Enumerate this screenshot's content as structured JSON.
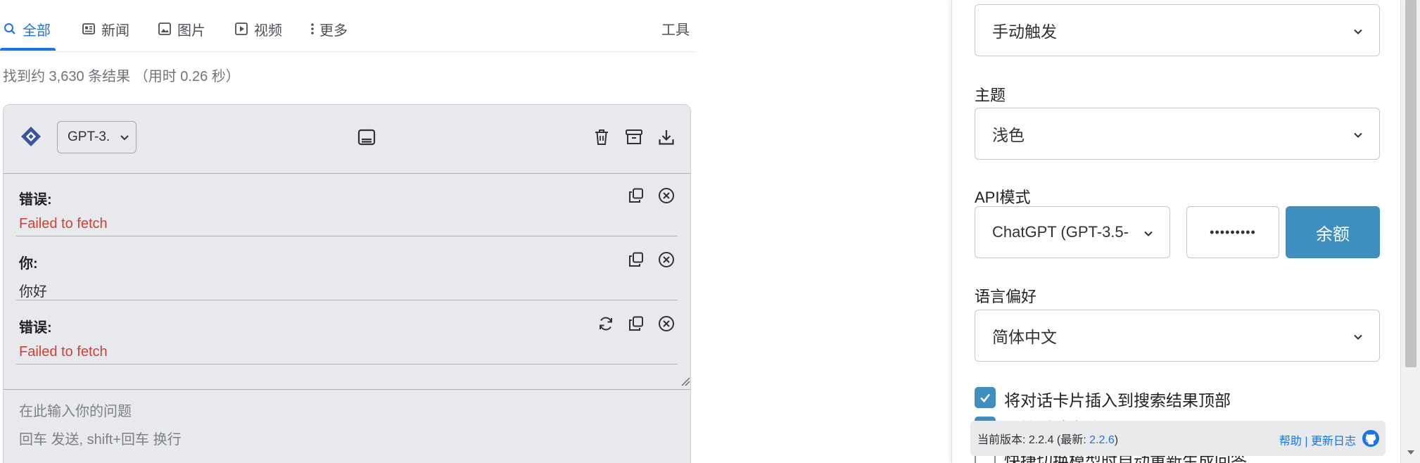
{
  "tabs": [
    {
      "label": "全部",
      "icon": "search-icon",
      "active": true
    },
    {
      "label": "新闻",
      "icon": "news-icon"
    },
    {
      "label": "图片",
      "icon": "image-icon"
    },
    {
      "label": "视频",
      "icon": "video-icon"
    },
    {
      "label": "更多",
      "icon": "more-vert-icon"
    }
  ],
  "tools_label": "工具",
  "result_stats": "找到约 3,630 条结果 （用时 0.26 秒）",
  "chat": {
    "model_value": "GPT-3.",
    "messages": [
      {
        "role": "错误:",
        "text": "Failed to fetch",
        "kind": "error"
      },
      {
        "role": "你:",
        "text": "你好",
        "kind": "user"
      },
      {
        "role": "错误:",
        "text": "Failed to fetch",
        "kind": "error"
      }
    ],
    "input_placeholder_line1": "在此输入你的问题",
    "input_placeholder_line2": "回车 发送, shift+回车 换行"
  },
  "settings": {
    "trigger_value": "手动触发",
    "theme_label": "主题",
    "theme_value": "浅色",
    "api_label": "API模式",
    "api_value": "ChatGPT (GPT-3.5-",
    "api_key_masked": "•••••••••",
    "balance_button": "余额",
    "language_label": "语言偏好",
    "language_value": "简体中文",
    "check1_label": "将对话卡片插入到搜索结果顶部",
    "check2_label": "回答时锁定滚动条",
    "check3_label": "快捷切换模型时自动重新生成回答"
  },
  "footer": {
    "version_prefix": "当前版本: 2.2.4 (最新: ",
    "version_latest": "2.2.6",
    "version_suffix": ")",
    "help": "帮助",
    "separator": "|",
    "changelog": "更新日志"
  },
  "colors": {
    "accent": "#1a73e8",
    "button": "#3e8fbf",
    "error": "#d23f31"
  }
}
